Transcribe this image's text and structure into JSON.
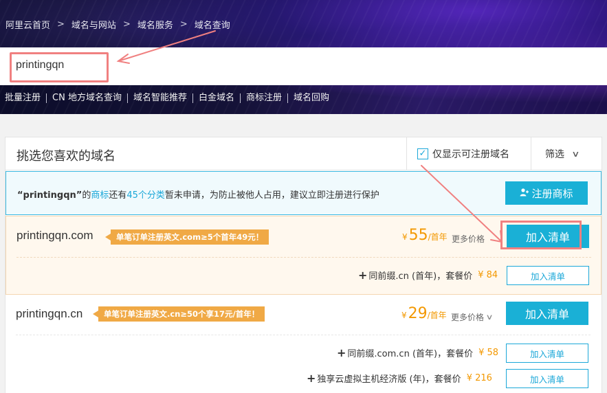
{
  "breadcrumb": [
    "阿里云首页",
    "域名与网站",
    "域名服务",
    "域名查询"
  ],
  "breadcrumb_sep": ">",
  "search": {
    "value": "printingqn"
  },
  "quicklinks": [
    "批量注册",
    "CN 地方域名查询",
    "域名智能推荐",
    "白金域名",
    "商标注册",
    "域名回购"
  ],
  "panel": {
    "title": "挑选您喜欢的域名",
    "only_available_label": "仅显示可注册域名",
    "only_available_checked": true,
    "filter_label": "筛选"
  },
  "notice": {
    "name": "“printingqn”",
    "t1": "的",
    "link1": "商标",
    "t2": "还有",
    "link2": "45个分类",
    "t3": "暂未申请，为防止被他人占用，建议立即注册进行保护",
    "button": "注册商标"
  },
  "results": [
    {
      "domain": "printingqn.com",
      "promo": "单笔订单注册英文.com≥5个首年49元！",
      "currency": "¥",
      "price": "55",
      "unit": "/首年",
      "more": "更多价格",
      "add": "加入清单",
      "bundles": [
        {
          "plus": "+",
          "text": "同前缀.cn (首年)，套餐价",
          "price": "¥ 84",
          "add": "加入清单"
        }
      ]
    },
    {
      "domain": "printingqn.cn",
      "promo": "单笔订单注册英文.cn≥50个享17元/首年！",
      "currency": "¥",
      "price": "29",
      "unit": "/首年",
      "more": "更多价格",
      "add": "加入清单",
      "bundles": [
        {
          "plus": "+",
          "text": "同前缀.com.cn (首年)，套餐价",
          "price": "¥ 58",
          "add": "加入清单"
        },
        {
          "plus": "+",
          "text": "独享云虚拟主机经济版 (年)，套餐价",
          "price": "¥ 216",
          "add": "加入清单"
        }
      ]
    }
  ],
  "colors": {
    "accent": "#1ab0d6",
    "price": "#f39800",
    "promo": "#f0a945",
    "annotation": "#f08080"
  }
}
